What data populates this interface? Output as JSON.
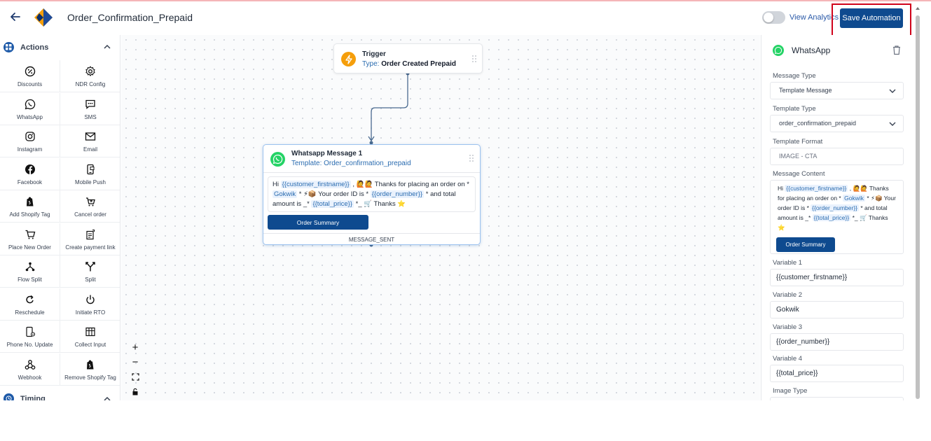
{
  "header": {
    "title": "Order_Confirmation_Prepaid",
    "view_analytics": "View Analytics",
    "save_label": "Save Automation"
  },
  "sidebar": {
    "actions_label": "Actions",
    "timing_label": "Timing",
    "items": [
      {
        "label": "Discounts",
        "icon": "discount-icon"
      },
      {
        "label": "NDR Config",
        "icon": "gear-icon"
      },
      {
        "label": "WhatsApp",
        "icon": "whatsapp-icon"
      },
      {
        "label": "SMS",
        "icon": "sms-icon"
      },
      {
        "label": "Instagram",
        "icon": "instagram-icon"
      },
      {
        "label": "Email",
        "icon": "email-icon"
      },
      {
        "label": "Facebook",
        "icon": "facebook-icon"
      },
      {
        "label": "Mobile Push",
        "icon": "mobile-push-icon"
      },
      {
        "label": "Add Shopify Tag",
        "icon": "shopify-icon"
      },
      {
        "label": "Cancel order",
        "icon": "cancel-cart-icon"
      },
      {
        "label": "Place New Order",
        "icon": "cart-icon"
      },
      {
        "label": "Create payment link",
        "icon": "payment-link-icon"
      },
      {
        "label": "Flow Split",
        "icon": "flow-split-icon"
      },
      {
        "label": "Split",
        "icon": "split-icon"
      },
      {
        "label": "Reschedule",
        "icon": "reschedule-icon"
      },
      {
        "label": "Initiate RTO",
        "icon": "power-icon"
      },
      {
        "label": "Phone No. Update",
        "icon": "phone-settings-icon"
      },
      {
        "label": "Collect Input",
        "icon": "collect-input-icon"
      },
      {
        "label": "Webhook",
        "icon": "webhook-icon"
      },
      {
        "label": "Remove Shopify Tag",
        "icon": "shopify-icon"
      }
    ]
  },
  "canvas": {
    "trigger": {
      "title": "Trigger",
      "type_label": "Type:",
      "type_value": "Order Created Prepaid"
    },
    "whatsapp_node": {
      "title": "Whatsapp Message 1",
      "template": "Template: Order_confirmation_prepaid",
      "msg": {
        "t1": "Hi ",
        "v1": "{{customer_firstname}}",
        "t2": " , 🙋🙋 Thanks for placing an order on * ",
        "v2": "Gokwik",
        "t3": " * ⚡📦 Your order ID is * ",
        "v3": "{{order_number}}",
        "t4": " * and total amount is _* ",
        "v4": "{{total_price}}",
        "t5": " *_ 🛒 Thanks ⭐"
      },
      "button_label": "Order Summary",
      "status": "MESSAGE_SENT"
    }
  },
  "panel": {
    "title": "WhatsApp",
    "message_type_label": "Message Type",
    "message_type_value": "Template Message",
    "template_type_label": "Template Type",
    "template_type_value": "order_confirmation_prepaid",
    "template_format_label": "Template Format",
    "template_format_value": "IMAGE - CTA",
    "message_content_label": "Message Content",
    "content": {
      "t1": "Hi ",
      "v1": "{{customer_firstname}}",
      "t2": " , 🙋🙋 Thanks for placing an order on * ",
      "v2": "Gokwik",
      "t3": " * ⚡📦 Your order ID is * ",
      "v3": "{{order_number}}",
      "t4": " * and total amount is _* ",
      "v4": "{{total_price}}",
      "t5": " *_ 🛒 Thanks ⭐"
    },
    "button_label": "Order Summary",
    "variables": [
      {
        "label": "Variable 1",
        "value": "{{customer_firstname}}"
      },
      {
        "label": "Variable 2",
        "value": "Gokwik"
      },
      {
        "label": "Variable 3",
        "value": "{{order_number}}"
      },
      {
        "label": "Variable 4",
        "value": "{{total_price}}"
      }
    ],
    "image_type_label": "Image Type"
  },
  "colors": {
    "primary": "#0e4a8f",
    "link": "#2b6cb0",
    "highlight": "#d0021b",
    "whatsapp": "#25d366",
    "trigger": "#f59e0b"
  }
}
